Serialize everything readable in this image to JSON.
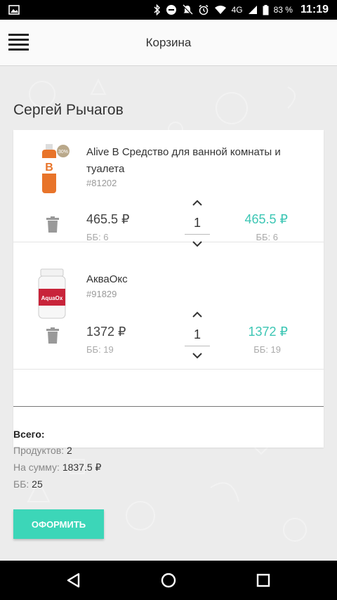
{
  "status_bar": {
    "network": "4G",
    "battery": "83 %",
    "time": "11:19"
  },
  "app_bar": {
    "title": "Корзина"
  },
  "customer": {
    "name": "Сергей Рычагов"
  },
  "cart": {
    "items": [
      {
        "name": "Alive B Средство для ванной комнаты и туалета",
        "code": "#81202",
        "price": "465.5 ₽",
        "bb": "ББ: 6",
        "quantity": "1",
        "total_price": "465.5 ₽",
        "total_bb": "ББ: 6",
        "image_label": "B",
        "badge": "30%"
      },
      {
        "name": "АкваОкс",
        "code": "#91829",
        "price": "1372 ₽",
        "bb": "ББ: 19",
        "quantity": "1",
        "total_price": "1372 ₽",
        "total_bb": "ББ: 19",
        "image_label": "AquaOx"
      }
    ]
  },
  "summary": {
    "title": "Всего:",
    "products_label": "Продуктов:",
    "products_value": "2",
    "sum_label": "На сумму:",
    "sum_value": "1837.5 ₽",
    "bb_label": "ББ:",
    "bb_value": "25"
  },
  "checkout": {
    "label": "ОФОРМИТЬ"
  },
  "colors": {
    "accent": "#3cd6b8",
    "total_price": "#3cc6b4"
  }
}
